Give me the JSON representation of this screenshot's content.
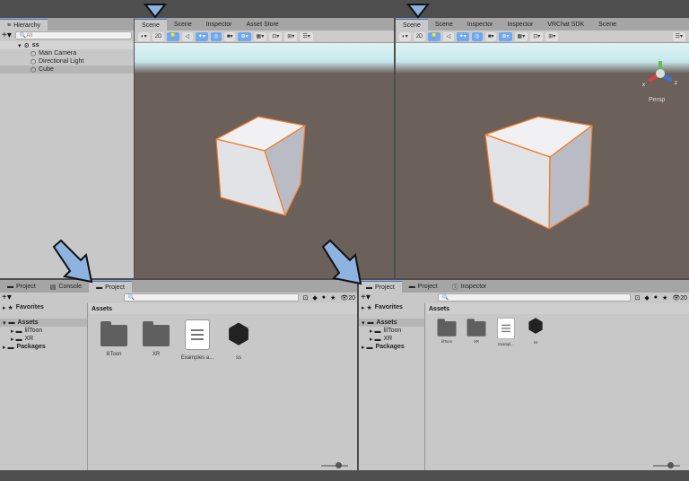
{
  "hierarchy": {
    "tab": "Hierarchy",
    "search_placeholder": "All",
    "scene": "ss",
    "items": [
      "Main Camera",
      "Directional Light",
      "Cube"
    ]
  },
  "scene_left": {
    "tabs": [
      "Scene",
      "Scene",
      "Inspector",
      "Asset Store"
    ],
    "toolbar": {
      "mode_2d": "2D"
    }
  },
  "scene_right": {
    "tabs": [
      "Scene",
      "Scene",
      "Inspector",
      "Inspector",
      "VRChat SDK",
      "Scene"
    ],
    "toolbar": {
      "mode_2d": "2D"
    },
    "gizmo": {
      "x": "x",
      "y": "y",
      "z": "z",
      "projection": "Persp"
    }
  },
  "project_left": {
    "tabs": [
      "Project",
      "Console",
      "Project"
    ],
    "favorites": "Favorites",
    "assets": "Assets",
    "subfolders": [
      "lilToon",
      "XR"
    ],
    "packages": "Packages",
    "breadcrumb": "Assets",
    "items": [
      "lilToon",
      "XR",
      "Examples a...",
      "ss"
    ],
    "count": "20"
  },
  "project_right": {
    "tabs": [
      "Project",
      "Project",
      "Inspector"
    ],
    "favorites": "Favorites",
    "assets": "Assets",
    "subfolders": [
      "lilToon",
      "XR"
    ],
    "packages": "Packages",
    "breadcrumb": "Assets",
    "items": [
      "lilToon",
      "XR",
      "Exampl...",
      "ss"
    ],
    "count": "20"
  },
  "colors": {
    "accent": "#3a79d6",
    "arrow": "#8fb3e0",
    "cube_outline": "#f07a2a"
  }
}
